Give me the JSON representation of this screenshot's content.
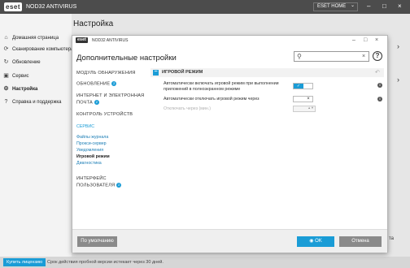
{
  "app": {
    "logo": "eset",
    "product": "NOD32 ANTIVIRUS",
    "home_menu": "ESET HOME",
    "home_chevron": "⌄",
    "minimize": "–",
    "maximize": "□",
    "close": "×",
    "page_title": "Настройка"
  },
  "main_nav": {
    "items": [
      {
        "label": "Домашняя страница",
        "icon": "⌂"
      },
      {
        "label": "Сканирование компьютера",
        "icon": "⟳"
      },
      {
        "label": "Обновление",
        "icon": "↻"
      },
      {
        "label": "Сервис",
        "icon": "▣"
      },
      {
        "label": "Настройка",
        "icon": "⚙"
      },
      {
        "label": "Справка и поддержка",
        "icon": "?"
      }
    ]
  },
  "right_chevrons": [
    "›",
    "›"
  ],
  "bottom": {
    "buy_label": "Купить лицензию",
    "trial_text": "Срок действия пробной версии истекает через 30 дней.",
    "right_fragment": "та"
  },
  "dialog": {
    "logo": "eset",
    "product": "NOD32 ANTIVIRUS",
    "minimize": "–",
    "maximize": "□",
    "close": "×",
    "title": "Дополнительные настройки",
    "search": {
      "placeholder": "",
      "value": "",
      "clear": "×"
    },
    "help": "?",
    "menu": [
      "МОДУЛЬ ОБНАРУЖЕНИЯ",
      "ОБНОВЛЕНИЕ",
      "ИНТЕРНЕТ И ЭЛЕКТРОННАЯ",
      "ПОЧТА",
      "КОНТРОЛЬ УСТРОЙСТВ",
      "ИНТЕРФЕЙС",
      "ПОЛЬЗОВАТЕЛЯ"
    ],
    "badge": "2",
    "service": {
      "header": "СЕРВИС",
      "items": [
        "Файлы журнала",
        "Прокси-сервер",
        "Уведомления",
        "Игровой режим",
        "Диагностика"
      ]
    },
    "section_title": "ИГРОВОЙ РЕЖИМ",
    "section_undo": "↶",
    "options": [
      {
        "label": "Автоматически включать игровой режим при выполнении приложений в полноэкранном режиме",
        "toggle_on": "✓",
        "toggle_off": ""
      },
      {
        "label": "Автоматически отключать игровой режим через",
        "toggle_on": "",
        "toggle_off": "×"
      }
    ],
    "disabled_label": "Отключать через (мин.)",
    "spin_arrows": "▲▼",
    "info": "i",
    "footer": {
      "default_label": "По умолчанию",
      "ok_label": "OK",
      "cancel_label": "Отмена"
    }
  }
}
